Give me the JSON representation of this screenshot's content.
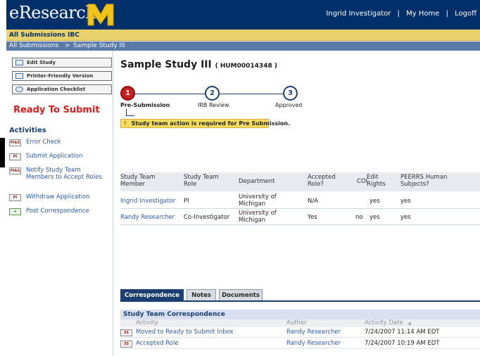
{
  "header": {
    "app_name": "eResearch",
    "logo_letter": "M",
    "user_link": "Ingrid Investigator",
    "separator": "|",
    "home_link": "My Home",
    "logout_link": "Logoff"
  },
  "nav": {
    "tabs": [
      "All Submissions",
      "IBC"
    ]
  },
  "breadcrumb": {
    "items": [
      "All Submissions",
      ">",
      "Sample Study III"
    ]
  },
  "sidebar": {
    "buttons": [
      {
        "label": "Edit Study",
        "icon": "edit-icon"
      },
      {
        "label": "Printer-Friendly Version",
        "icon": "printer-icon"
      },
      {
        "label": "Application Checklist",
        "icon": "checklist-icon"
      }
    ],
    "status": "Ready To Submit",
    "activities_title": "Activities",
    "activities": [
      {
        "tag": "PI&S",
        "label": "Error Check"
      },
      {
        "tag": "PI",
        "label": "Submit Application"
      },
      {
        "tag": "PI&S",
        "label": "Notify Study Team Members to Accept Roles"
      },
      {
        "tag": "PI",
        "label": "Withdraw Application"
      },
      {
        "tag": "+",
        "label": "Post Correspondence"
      }
    ]
  },
  "study": {
    "title": "Sample Study III",
    "id": "( HUM00014348 )"
  },
  "workflow": {
    "steps": [
      {
        "number": "1",
        "label": "Pre-Submission",
        "active": true
      },
      {
        "number": "2",
        "label": "IRB Review",
        "active": false
      },
      {
        "number": "3",
        "label": "Approved",
        "active": false
      }
    ],
    "notice_icon": "!",
    "notice": "Study team action is required for Pre Submission."
  },
  "team_table": {
    "headers": [
      "Study Team Member",
      "Study Team Role",
      "Department",
      "Accepted Role?",
      "COI",
      "Edit Rights",
      "PEERRS Human Subjects?"
    ],
    "rows": [
      {
        "member": "Ingrid Investigator",
        "role": "PI",
        "department": "University of Michigan",
        "accepted": "N/A",
        "coi": "",
        "edit": "yes",
        "peerrs": "yes"
      },
      {
        "member": "Randy Researcher",
        "role": "Co-Investigator",
        "department": "University of Michigan",
        "accepted": "Yes",
        "coi": "no",
        "edit": "yes",
        "peerrs": "yes"
      }
    ]
  },
  "content_tabs": [
    "Correspondence",
    "Notes",
    "Documents"
  ],
  "correspondence": {
    "title": "Study Team Correspondence",
    "headers": {
      "activity": "Activity",
      "author": "Author",
      "date": "Activity Date"
    },
    "sort_indicator": "▲",
    "rows": [
      {
        "tag": "SS",
        "activity": "Moved to Ready to Submit Inbox",
        "author": "Randy Researcher",
        "date": "7/24/2007 11:14 AM EDT"
      },
      {
        "tag": "SS",
        "activity": "Accepted Role",
        "author": "Randy Researcher",
        "date": "7/24/2007 10:19 AM EDT"
      }
    ]
  }
}
